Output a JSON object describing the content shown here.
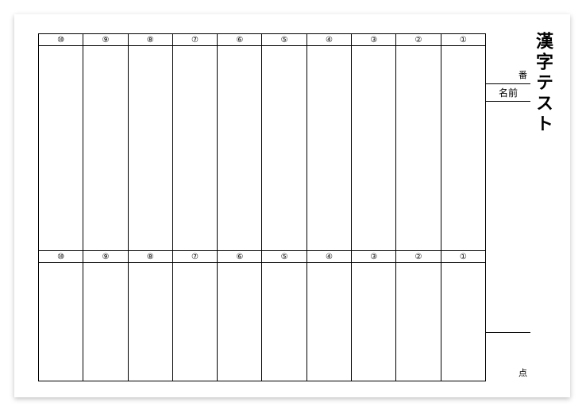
{
  "title": "漢字テスト",
  "labels": {
    "number": "番",
    "name": "名前",
    "score": "点"
  },
  "columns_row1": [
    "⑩",
    "⑨",
    "⑧",
    "⑦",
    "⑥",
    "⑤",
    "④",
    "③",
    "②",
    "①"
  ],
  "columns_row2": [
    "⑩",
    "⑨",
    "⑧",
    "⑦",
    "⑥",
    "⑤",
    "④",
    "③",
    "②",
    "①"
  ]
}
